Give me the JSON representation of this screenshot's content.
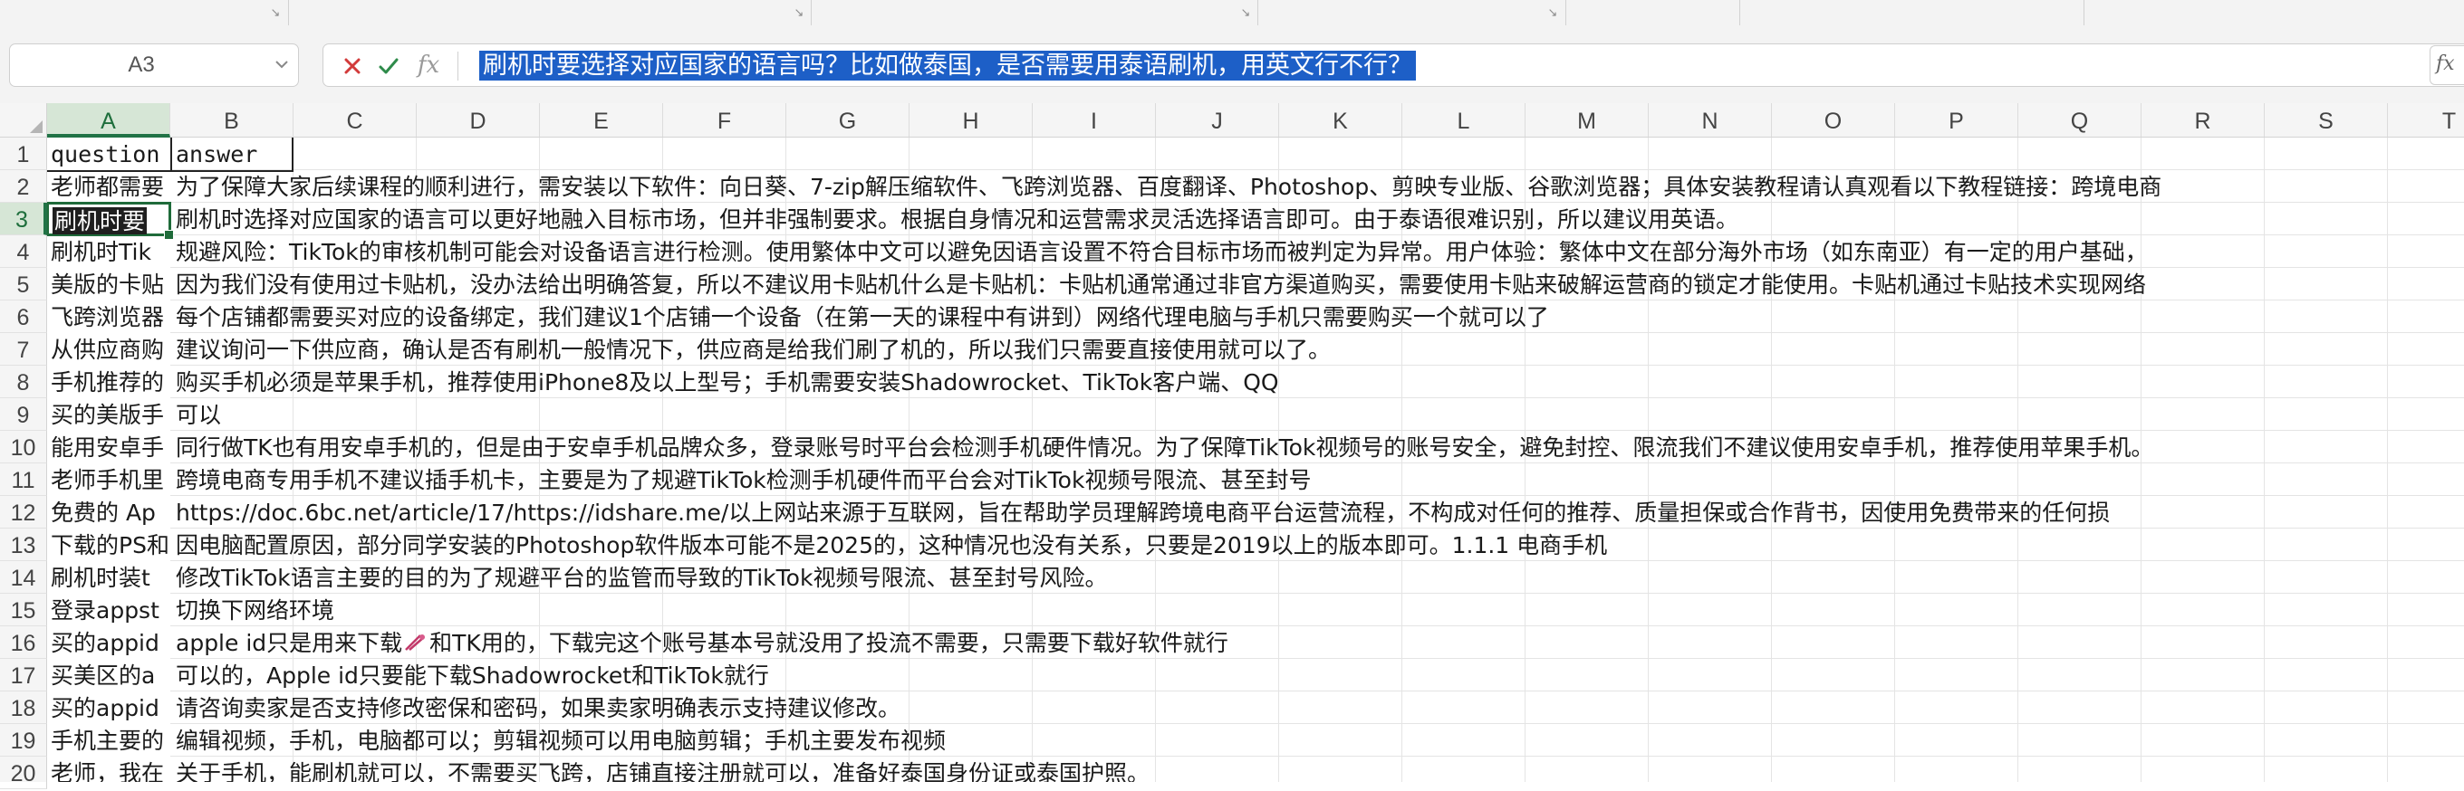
{
  "formula_bar": {
    "name_box": "A3",
    "fx_label": "fx",
    "expand_label": "fx",
    "formula_text": "刷机时要选择对应国家的语言吗？比如做泰国，是否需要用泰语刷机，用英文行不行？"
  },
  "grid": {
    "columns": [
      "A",
      "B",
      "C",
      "D",
      "E",
      "F",
      "G",
      "H",
      "I",
      "J",
      "K",
      "L",
      "M",
      "N",
      "O",
      "P",
      "Q",
      "R",
      "S",
      "T"
    ],
    "active_column": "A",
    "active_row": "3",
    "rows": [
      {
        "num": "1",
        "a": "question",
        "b": "answer"
      },
      {
        "num": "2",
        "a": "老师都需要",
        "b": "为了保障大家后续课程的顺利进行，需安装以下软件：向日葵、7-zip解压缩软件、飞跨浏览器、百度翻译、Photoshop、剪映专业版、谷歌浏览器；具体安装教程请认真观看以下教程链接：跨境电商"
      },
      {
        "num": "3",
        "a": "刷机时要",
        "b": "刷机时选择对应国家的语言可以更好地融入目标市场，但并非强制要求。根据自身情况和运营需求灵活选择语言即可。由于泰语很难识别，所以建议用英语。"
      },
      {
        "num": "4",
        "a": "刷机时Tik",
        "b": "规避风险：TikTok的审核机制可能会对设备语言进行检测。使用繁体中文可以避免因语言设置不符合目标市场而被判定为异常。用户体验：繁体中文在部分海外市场（如东南亚）有一定的用户基础，"
      },
      {
        "num": "5",
        "a": "美版的卡贴",
        "b": "因为我们没有使用过卡贴机，没办法给出明确答复，所以不建议用卡贴机什么是卡贴机：卡贴机通常通过非官方渠道购买，需要使用卡贴来破解运营商的锁定才能使用。卡贴机通过卡贴技术实现网络"
      },
      {
        "num": "6",
        "a": "飞跨浏览器",
        "b": "每个店铺都需要买对应的设备绑定，我们建议1个店铺一个设备（在第一天的课程中有讲到）网络代理电脑与手机只需要购买一个就可以了"
      },
      {
        "num": "7",
        "a": "从供应商购",
        "b": "建议询问一下供应商，确认是否有刷机一般情况下，供应商是给我们刷了机的，所以我们只需要直接使用就可以了。"
      },
      {
        "num": "8",
        "a": "手机推荐的",
        "b": "购买手机必须是苹果手机，推荐使用iPhone8及以上型号；手机需要安装Shadowrocket、TikTok客户端、QQ"
      },
      {
        "num": "9",
        "a": "买的美版手",
        "b": "可以"
      },
      {
        "num": "10",
        "a": "能用安卓手",
        "b": "同行做TK也有用安卓手机的，但是由于安卓手机品牌众多，登录账号时平台会检测手机硬件情况。为了保障TikTok视频号的账号安全，避免封控、限流我们不建议使用安卓手机，推荐使用苹果手机。"
      },
      {
        "num": "11",
        "a": "老师手机里",
        "b": "跨境电商专用手机不建议插手机卡，主要是为了规避TikTok检测手机硬件而平台会对TikTok视频号限流、甚至封号"
      },
      {
        "num": "12",
        "a": "免费的 Ap",
        "b": "https://doc.6bc.net/article/17/https://idshare.me/以上网站来源于互联网，旨在帮助学员理解跨境电商平台运营流程，不构成对任何的推荐、质量担保或合作背书，因使用免费带来的任何损"
      },
      {
        "num": "13",
        "a": "下载的PS和",
        "b": "因电脑配置原因，部分同学安装的Photoshop软件版本可能不是2025的，这种情况也没有关系，只要是2019以上的版本即可。1.1.1 电商手机"
      },
      {
        "num": "14",
        "a": "刷机时装t",
        "b": "修改TikTok语言主要的目的为了规避平台的监管而导致的TikTok视频号限流、甚至封号风险。"
      },
      {
        "num": "15",
        "a": "登录appst",
        "b": "切换下网络环境"
      },
      {
        "num": "16",
        "a": "买的appid",
        "b_before": "apple id只是用来下载",
        "b_after": "和TK用的，下载完这个账号基本号就没用了投流不需要，只需要下载好软件就行"
      },
      {
        "num": "17",
        "a": "买美区的a",
        "b": "可以的，Apple id只要能下载Shadowrocket和TikTok就行"
      },
      {
        "num": "18",
        "a": "买的appid",
        "b": "请咨询卖家是否支持修改密保和密码，如果卖家明确表示支持建议修改。"
      },
      {
        "num": "19",
        "a": "手机主要的",
        "b": "编辑视频，手机，电脑都可以；剪辑视频可以用电脑剪辑；手机主要发布视频"
      },
      {
        "num": "20",
        "a": "老师，我在",
        "b": "关于手机，能刷机就可以，不需要买飞跨，店铺直接注册就可以，准备好泰国身份证或泰国护照。"
      }
    ]
  }
}
